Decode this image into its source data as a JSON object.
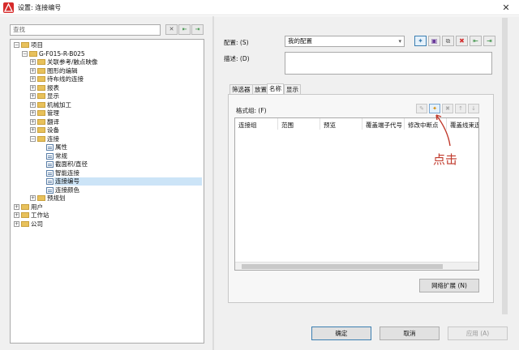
{
  "window": {
    "title": "设置: 连接编号",
    "close_glyph": "✕"
  },
  "left": {
    "search_placeholder": "查找",
    "tree": [
      {
        "level": 0,
        "type": "folder",
        "expander": "−",
        "label": "项目"
      },
      {
        "level": 1,
        "type": "folder",
        "expander": "−",
        "label": "G-F015-R-B025"
      },
      {
        "level": 2,
        "type": "folder",
        "expander": "+",
        "label": "关联参考/触点映像"
      },
      {
        "level": 2,
        "type": "folder",
        "expander": "+",
        "label": "图形的编辑"
      },
      {
        "level": 2,
        "type": "folder",
        "expander": "+",
        "label": "待布线的连接"
      },
      {
        "level": 2,
        "type": "folder",
        "expander": "+",
        "label": "报表"
      },
      {
        "level": 2,
        "type": "folder",
        "expander": "+",
        "label": "显示"
      },
      {
        "level": 2,
        "type": "folder",
        "expander": "+",
        "label": "机械加工"
      },
      {
        "level": 2,
        "type": "folder",
        "expander": "+",
        "label": "管理"
      },
      {
        "level": 2,
        "type": "folder",
        "expander": "+",
        "label": "翻译"
      },
      {
        "level": 2,
        "type": "folder",
        "expander": "+",
        "label": "设备"
      },
      {
        "level": 2,
        "type": "folder",
        "expander": "−",
        "label": "连接"
      },
      {
        "level": 3,
        "type": "doc",
        "expander": "",
        "label": "属性"
      },
      {
        "level": 3,
        "type": "doc",
        "expander": "",
        "label": "常规"
      },
      {
        "level": 3,
        "type": "doc",
        "expander": "",
        "label": "截面积/直径"
      },
      {
        "level": 3,
        "type": "doc",
        "expander": "",
        "label": "智能连接"
      },
      {
        "level": 3,
        "type": "doc",
        "expander": "",
        "label": "连接编号",
        "selected": true
      },
      {
        "level": 3,
        "type": "doc",
        "expander": "",
        "label": "连接颜色"
      },
      {
        "level": 2,
        "type": "folder",
        "expander": "+",
        "label": "预规划"
      },
      {
        "level": 0,
        "type": "folder",
        "expander": "+",
        "label": "用户"
      },
      {
        "level": 0,
        "type": "folder",
        "expander": "+",
        "label": "工作站"
      },
      {
        "level": 0,
        "type": "folder",
        "expander": "+",
        "label": "公司"
      }
    ]
  },
  "right": {
    "config_label": "配置: (S)",
    "config_value": "我的配置",
    "desc_label": "描述: (D)",
    "tabs": [
      "筛选器",
      "放置",
      "名称",
      "显示"
    ],
    "selected_tab": "名称",
    "format_group_label": "格式组: (F)",
    "columns": [
      "连接组",
      "范围",
      "预览",
      "覆盖端子代号",
      "修改中断点",
      "覆盖线束连"
    ],
    "network_button": "网络扩展 (N)",
    "annotation": "点击"
  },
  "footer": {
    "ok": "确定",
    "cancel": "取消",
    "apply": "应用 (A)"
  },
  "colors": {
    "accent": "#3c7fb1",
    "selection": "#cce4f7",
    "annotation": "#c0392b",
    "folder": "#e8c15b"
  }
}
